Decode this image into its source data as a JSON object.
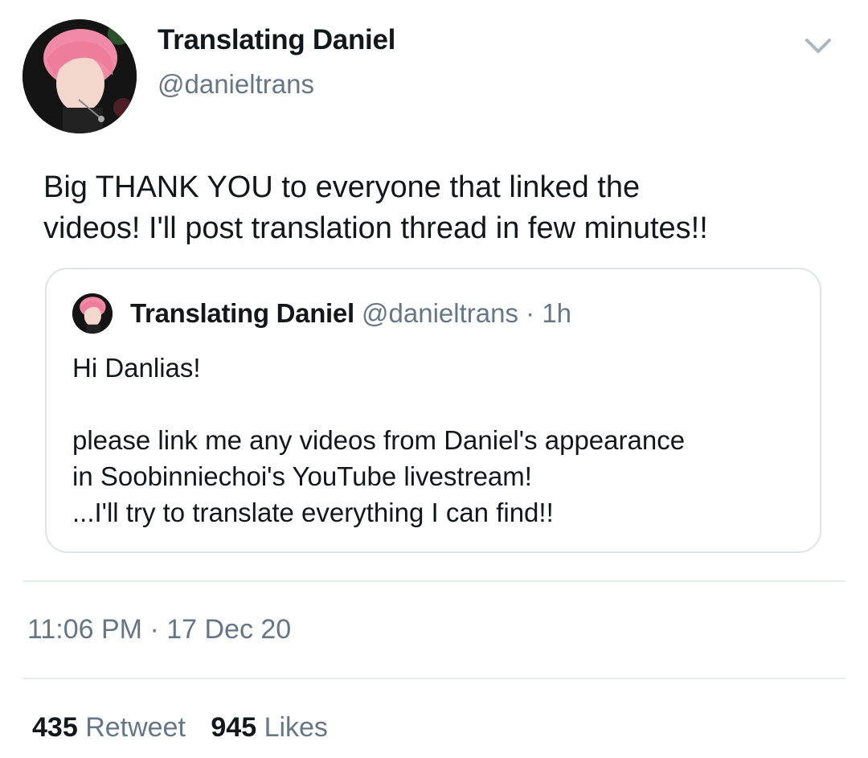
{
  "tweet": {
    "author": {
      "name": "Translating Daniel",
      "handle": "@danieltrans"
    },
    "text_lines": [
      "Big THANK YOU to everyone that linked the",
      "videos! I'll post translation thread in few minutes!!"
    ],
    "menu_icon": "chevron-down-icon",
    "quoted": {
      "name": "Translating Daniel",
      "handle": "@danieltrans",
      "separator": "·",
      "time": "1h",
      "lines": [
        "Hi Danlias!",
        "",
        "please link me any videos from Daniel's appearance",
        "in Soobinniechoi's YouTube livestream!",
        "...I'll try to translate everything I can find!!"
      ]
    },
    "timestamp": "11:06 PM · 17 Dec 20",
    "stats": {
      "retweets_count": "435",
      "retweets_label": "Retweet",
      "likes_count": "945",
      "likes_label": "Likes"
    }
  },
  "colors": {
    "text": "#14171a",
    "secondary": "#657786",
    "border": "#dfe3e7",
    "divider": "#e6ecf0",
    "avatar_hair": "#f08aa6"
  }
}
